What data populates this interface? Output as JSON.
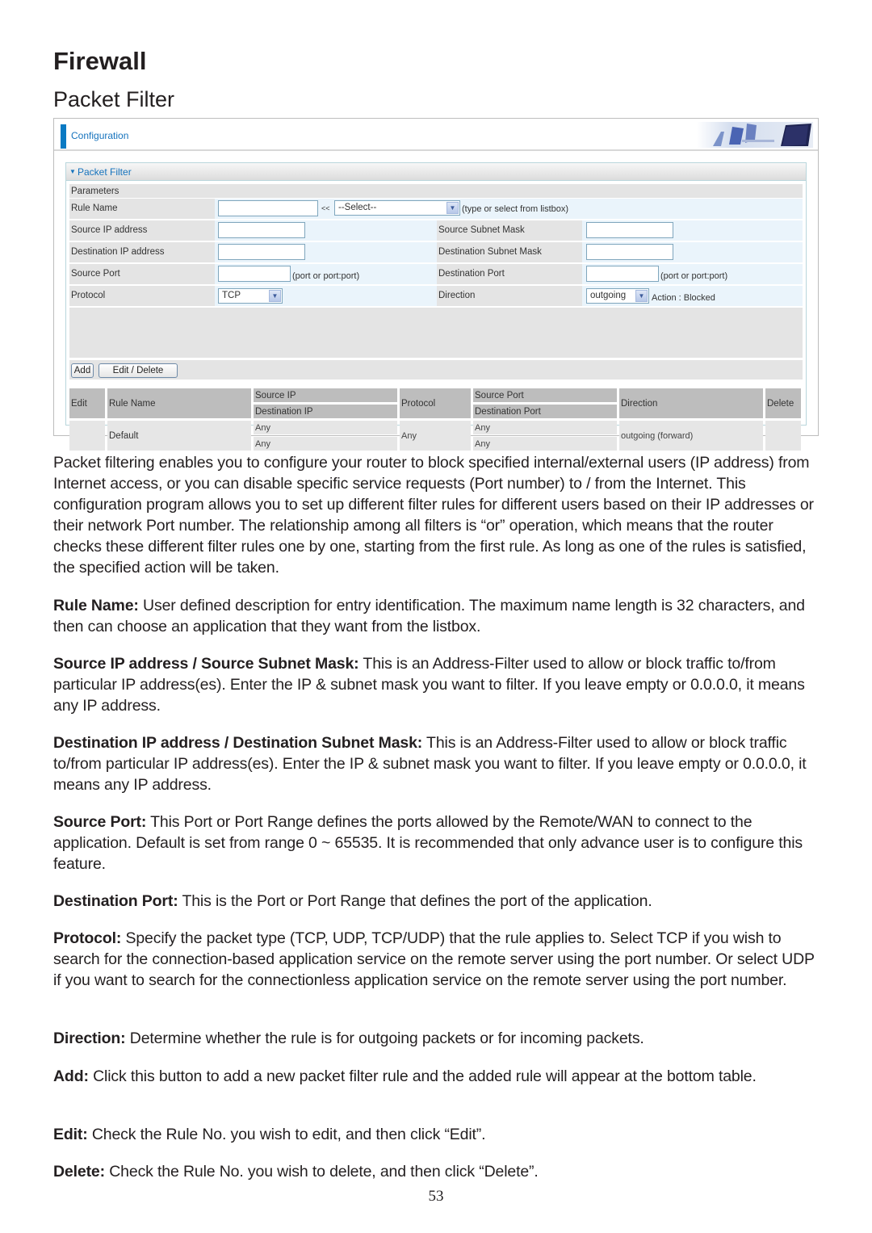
{
  "page": {
    "title": "Firewall",
    "subtitle": "Packet Filter",
    "page_number": "53"
  },
  "ui": {
    "header_label": "Configuration",
    "section_label": "Packet Filter",
    "parameters_label": "Parameters",
    "fields": {
      "rule_name": {
        "label": "Rule Name",
        "value": "",
        "arrow_label": "<<",
        "select_value": "--Select--",
        "hint": "(type or select from listbox)"
      },
      "source_ip": {
        "label": "Source IP address",
        "value": ""
      },
      "source_subnet": {
        "label": "Source Subnet Mask",
        "value": ""
      },
      "dest_ip": {
        "label": "Destination IP address",
        "value": ""
      },
      "dest_subnet": {
        "label": "Destination Subnet Mask",
        "value": ""
      },
      "source_port": {
        "label": "Source Port",
        "value": "",
        "hint": "(port or port:port)"
      },
      "dest_port": {
        "label": "Destination Port",
        "value": "",
        "hint": "(port or port:port)"
      },
      "protocol": {
        "label": "Protocol",
        "value": "TCP"
      },
      "direction": {
        "label": "Direction",
        "value": "outgoing",
        "action_text": "Action : Blocked"
      }
    },
    "buttons": {
      "add": "Add",
      "edit_delete": "Edit / Delete"
    },
    "table": {
      "headers": {
        "edit": "Edit",
        "rule_name": "Rule Name",
        "source_ip": "Source IP",
        "destination_ip": "Destination IP",
        "protocol": "Protocol",
        "source_port": "Source Port",
        "destination_port": "Destination Port",
        "direction": "Direction",
        "delete": "Delete"
      },
      "rows": [
        {
          "edit": "",
          "rule_name": "Default",
          "source_ip": "Any",
          "destination_ip": "Any",
          "protocol": "Any",
          "source_port": "Any",
          "destination_port": "Any",
          "direction": "outgoing (forward)",
          "delete": ""
        }
      ]
    }
  },
  "content": {
    "intro": "Packet filtering enables you to configure your router to block specified internal/external users (IP address) from Internet access, or you can disable specific service requests (Port number) to / from the Internet. This configuration program allows you to set up different filter rules for different users based on their IP addresses or their network Port number. The relationship among all filters is “or” operation, which means that the router checks these different filter rules one by one, starting from the first rule. As long as one of the rules is satisfied, the specified action will be taken.",
    "definitions": [
      {
        "term": "Rule Name:",
        "text": " User defined description for entry identification. The maximum name length is 32 characters, and then can choose an application that they want from the listbox."
      },
      {
        "term": "Source IP address / Source Subnet Mask:",
        "text": " This is an Address-Filter used to allow or block traffic to/from particular IP address(es). Enter the IP & subnet mask you want to filter. If you leave empty or 0.0.0.0, it means any IP address."
      },
      {
        "term": "Destination IP address / Destination Subnet Mask:",
        "text": " This is an Address-Filter used to allow or block traffic to/from particular IP address(es). Enter the IP & subnet mask you want to filter. If you leave empty or 0.0.0.0, it means any IP address."
      },
      {
        "term": "Source Port:",
        "text": " This Port or Port Range defines the ports allowed by the Remote/WAN to connect to the application. Default is set from range 0 ~ 65535. It is recommended that only advance user is to configure this feature."
      },
      {
        "term": "Destination Port:",
        "text": " This is the Port or Port Range that defines the port of the application."
      },
      {
        "term": "Protocol:",
        "text": " Specify the packet type (TCP, UDP, TCP/UDP) that the rule applies to. Select TCP if you wish to search for the connection-based application service on the remote server using the port number. Or select UDP if you want to search for the connectionless application service on the remote server using the port number."
      },
      {
        "term": "Direction:",
        "text": " Determine whether the rule is for outgoing packets or for incoming packets."
      },
      {
        "term": "Add:",
        "text": " Click this button to add a new packet filter rule and the added rule will appear at the bottom table."
      },
      {
        "term": "Edit:",
        "text": " Check the Rule No. you wish to edit, and then click “Edit”."
      },
      {
        "term": "Delete:",
        "text": " Check the Rule No. you wish to delete, and then click “Delete”."
      }
    ]
  }
}
